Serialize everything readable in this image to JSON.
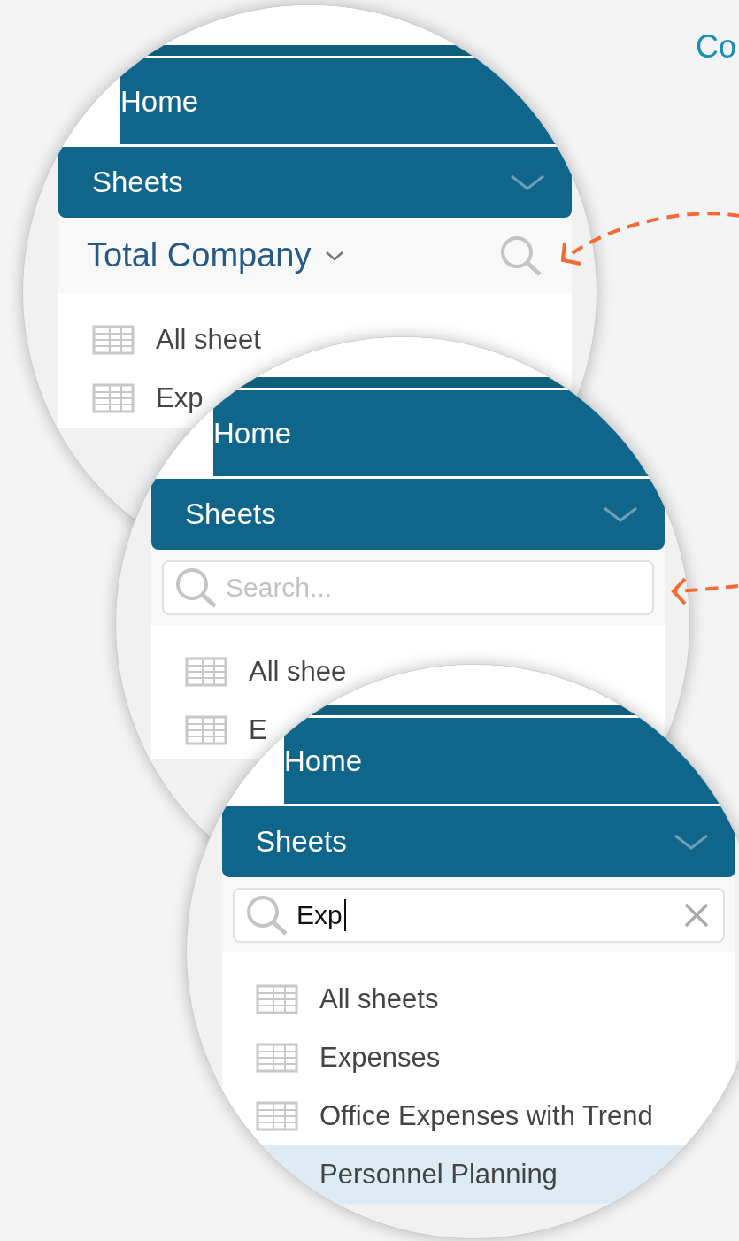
{
  "heading": "Co",
  "magnifiers": [
    {
      "nav": [
        {
          "label": "Home"
        },
        {
          "label": "Sheets"
        }
      ],
      "header": {
        "kind": "selector",
        "label": "Total Company"
      },
      "items": [
        {
          "label": "All sheet",
          "selected": false
        },
        {
          "label": "Exp",
          "selected": false
        }
      ]
    },
    {
      "nav": [
        {
          "label": "Home"
        },
        {
          "label": "Sheets"
        }
      ],
      "header": {
        "kind": "search",
        "placeholder": "Search..."
      },
      "items": [
        {
          "label": "All shee",
          "selected": false
        },
        {
          "label": "E",
          "selected": false
        }
      ]
    },
    {
      "nav": [
        {
          "label": "Home"
        },
        {
          "label": "Sheets"
        }
      ],
      "header": {
        "kind": "search",
        "value": "Exp"
      },
      "items": [
        {
          "label": "All sheets",
          "selected": false
        },
        {
          "label": "Expenses",
          "selected": false
        },
        {
          "label": "Office Expenses with Trend",
          "selected": false
        },
        {
          "label": "Personnel Planning",
          "selected": true,
          "icon": false
        }
      ]
    }
  ]
}
